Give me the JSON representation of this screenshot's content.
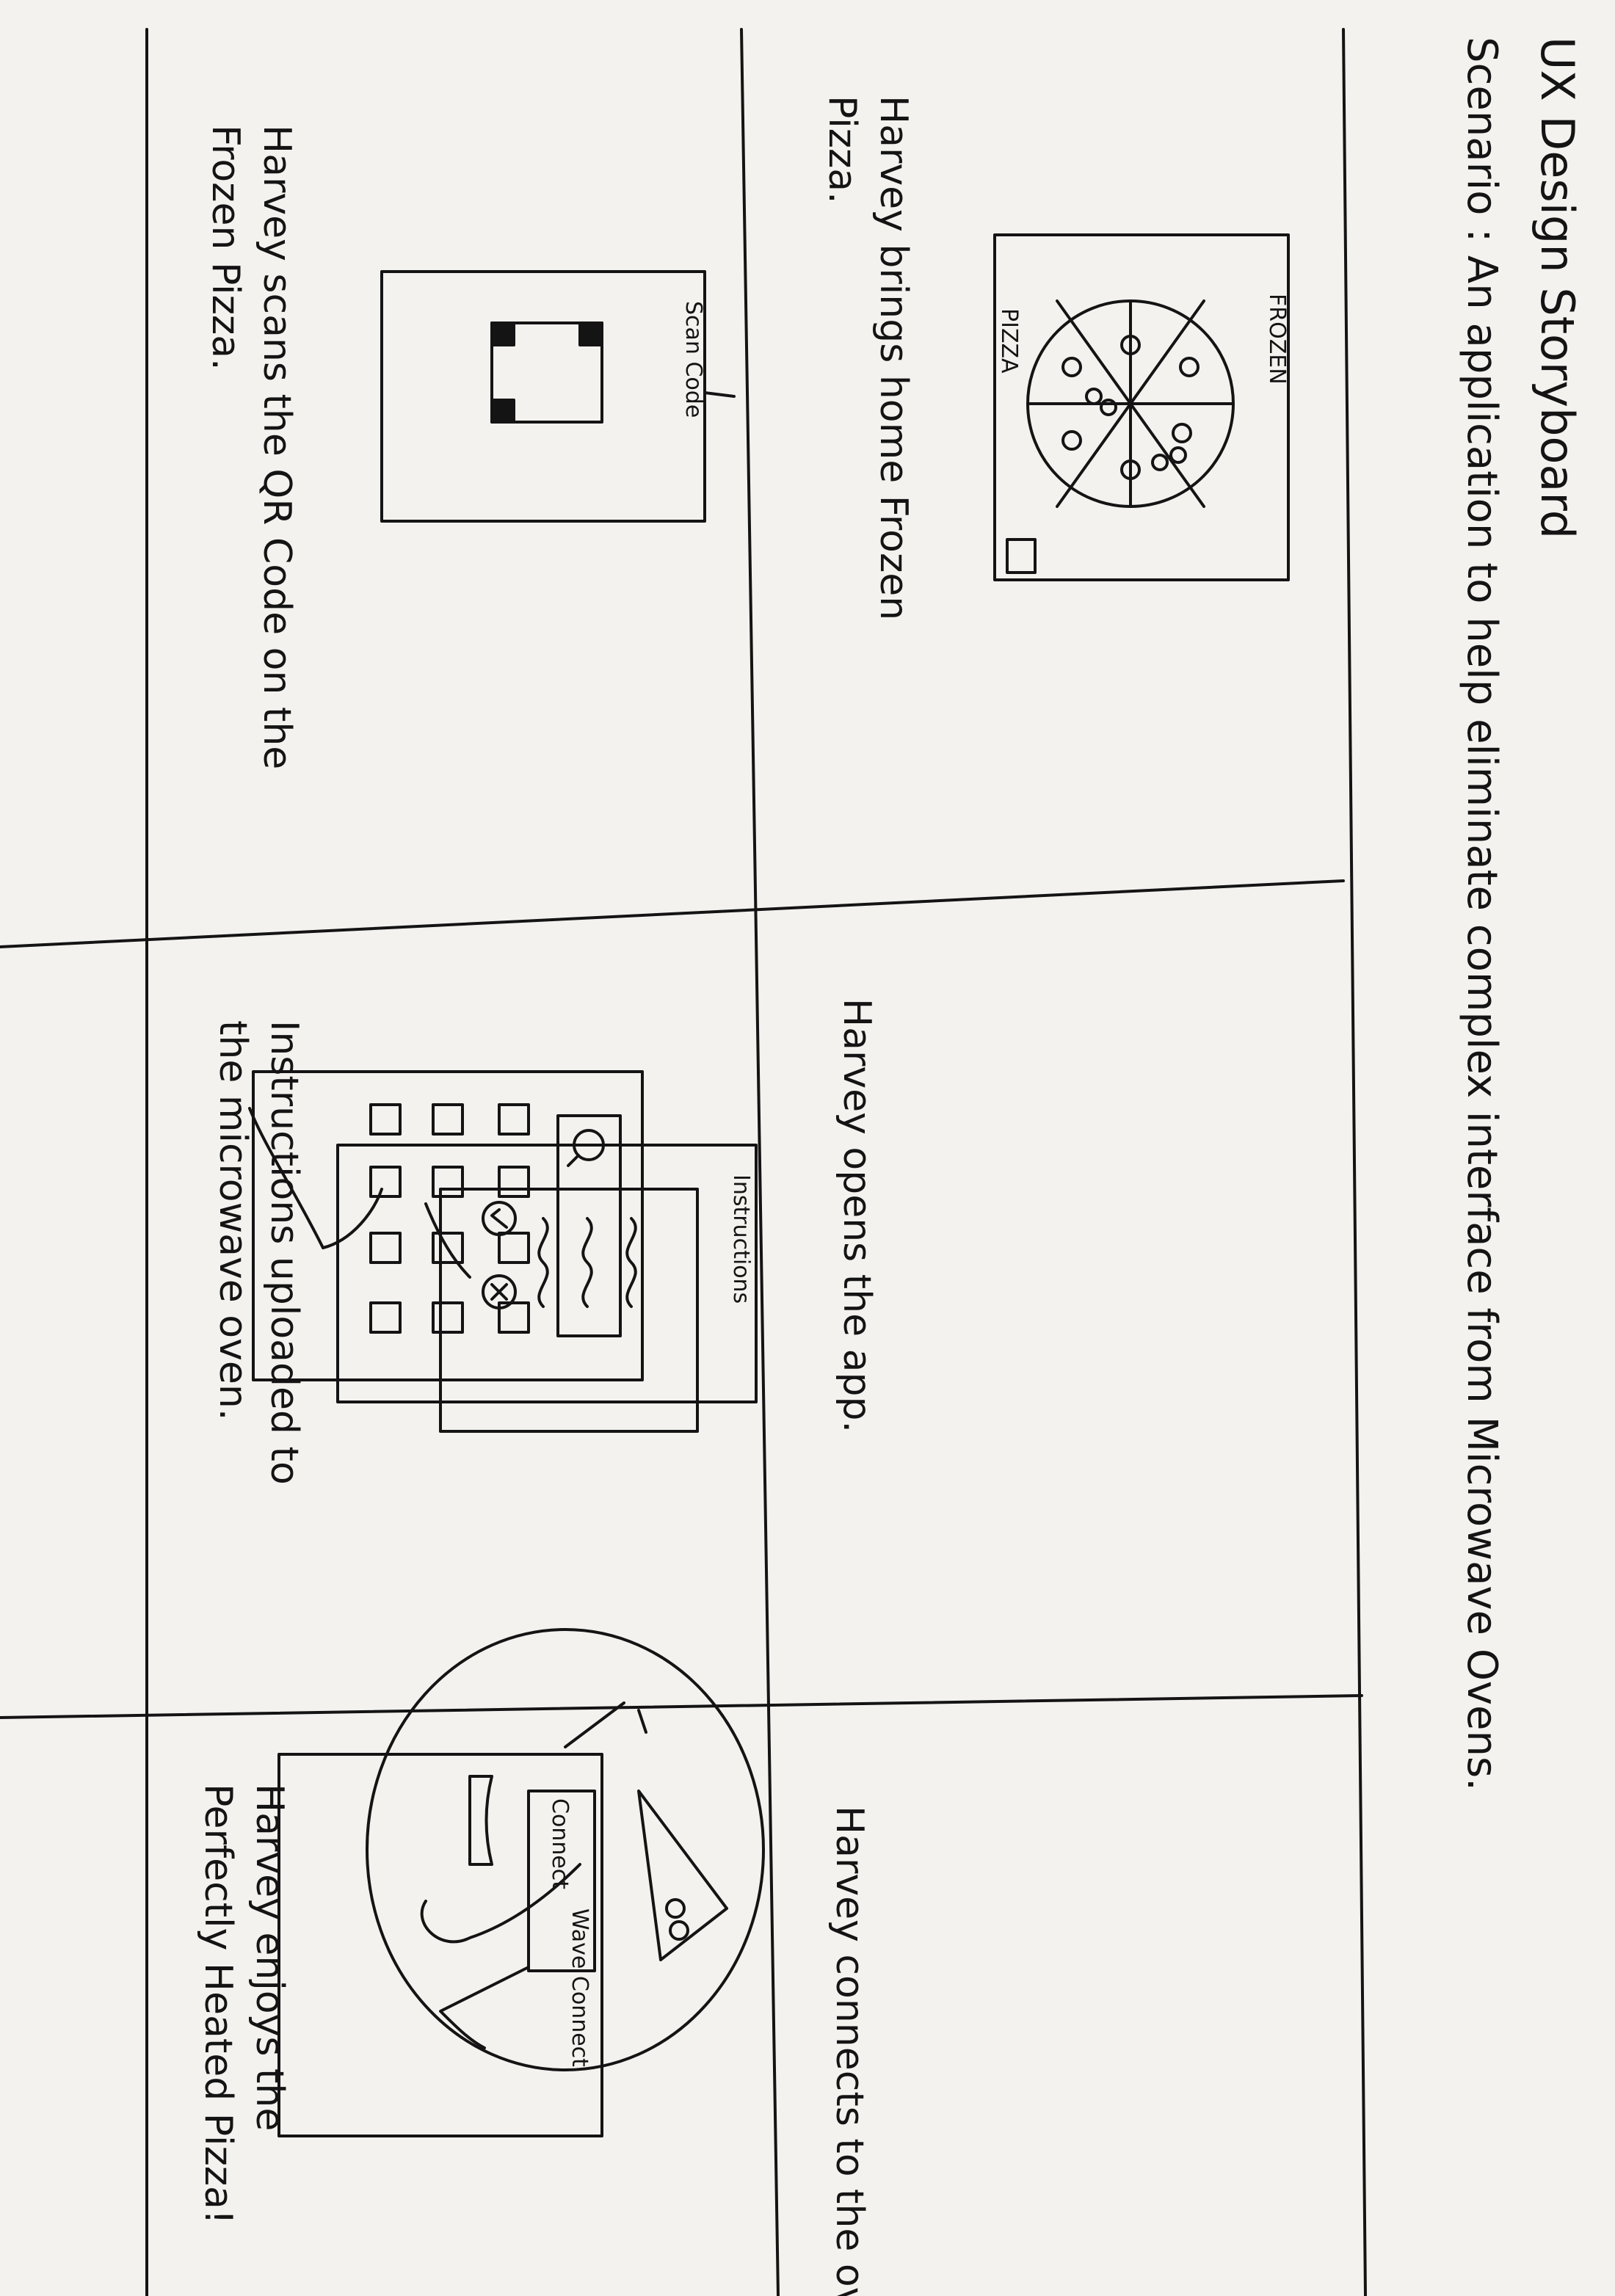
{
  "title": "UX Design Storyboard",
  "scenario": "Scenario : An application to help eliminate complex interface from Microwave Ovens.",
  "panels": [
    {
      "caption_line1": "Harvey brings home Frozen",
      "caption_line2": "Pizza.",
      "box_label_top": "FROZEN",
      "box_label_bottom": "PIZZA"
    },
    {
      "caption_line1": "Harvey opens the app."
    },
    {
      "caption_line1": "Harvey connects to the oven",
      "screen_title": "Wave Connect",
      "button_label": "Connect"
    },
    {
      "caption_line1": "Harvey scans the QR Code on the",
      "caption_line2": "Frozen Pizza.",
      "screen_title": "Scan Code"
    },
    {
      "caption_line1": "Instructions uploaded to",
      "caption_line2": "the microwave oven.",
      "screen_title": "Instructions"
    },
    {
      "caption_line1": "Harvey enjoys the",
      "caption_line2": "Perfectly Heated Pizza!"
    }
  ],
  "colors": {
    "paper": "#f3f2ef",
    "ink": "#141414"
  }
}
